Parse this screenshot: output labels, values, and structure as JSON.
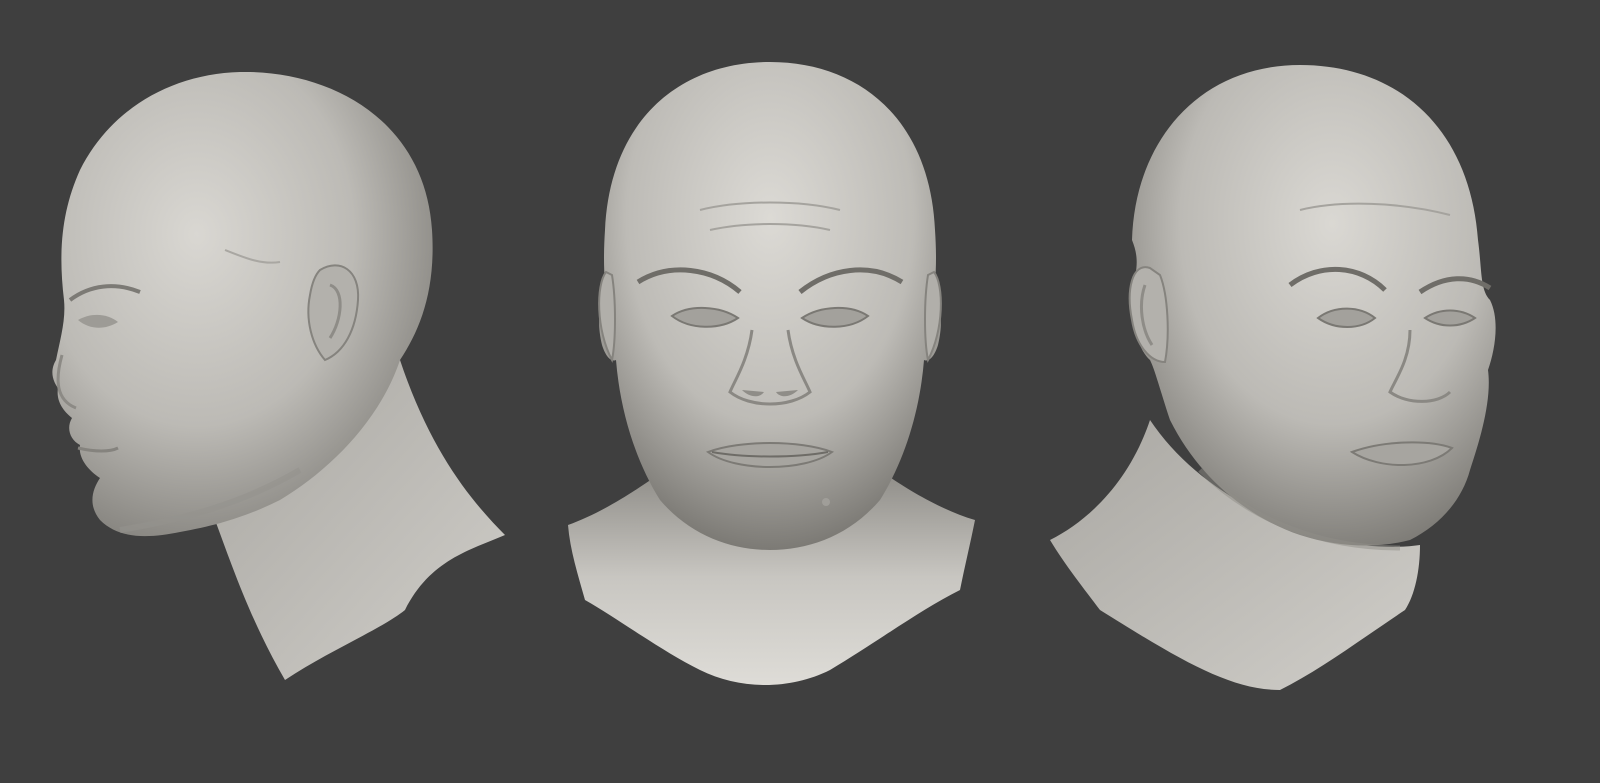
{
  "scene": {
    "background": "#3f3f3f",
    "material_color": "#c4c2bd",
    "material_shadow": "#6e6c68",
    "views": [
      {
        "name": "left-profile",
        "icon": "sculpt-head-side"
      },
      {
        "name": "front",
        "icon": "sculpt-head-front"
      },
      {
        "name": "right-three-quarter",
        "icon": "sculpt-head-three-quarter"
      }
    ]
  }
}
